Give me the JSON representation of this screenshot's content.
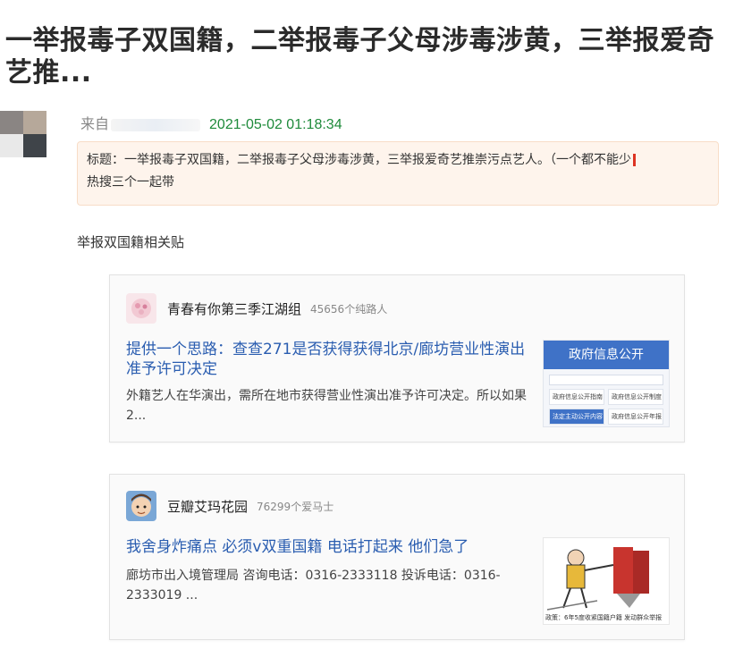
{
  "post": {
    "title": "一举报毒子双国籍，二举报毒子父母涉毒涉黄，三举报爱奇艺推...",
    "from_label": "来自",
    "timestamp": "2021-05-02 01:18:34"
  },
  "notice": {
    "line1": "标题：一举报毒子双国籍，二举报毒子父母涉毒涉黄，三举报爱奇艺推崇污点艺人。（一个都不能少",
    "line2": "热搜三个一起带"
  },
  "section_label": "举报双国籍相关贴",
  "cards": [
    {
      "group_name": "青春有你第三季江湖组",
      "member_count": "45656个纯路人",
      "post_title": "提供一个思路：查查271是否获得获得北京/廊坊营业性演出准予许可决定",
      "excerpt": "外籍艺人在华演出，需所在地市获得营业性演出准予许可决定。所以如果2...",
      "thumb": {
        "header": "政府信息公开",
        "cells": [
          "政府信息公开指南",
          "政府信息公开制度",
          "法定主动公开内容",
          "政府信息公开年报"
        ]
      }
    },
    {
      "group_name": "豆瓣艾玛花园",
      "member_count": "76299个爱马士",
      "post_title": "我舍身炸痛点 必须v双重国籍 电话打起来 他们急了",
      "excerpt": "廊坊市出入境管理局 咨询电话：0316-2333118 投诉电话：0316-2333019 ...",
      "thumb": {
        "caption": "政策：6年5度收紧国籍户籍 发动群众举报"
      }
    }
  ],
  "colors": {
    "link": "#2a5db0",
    "timestamp": "#1e8a3a",
    "notice_bg": "#fef4ec"
  }
}
